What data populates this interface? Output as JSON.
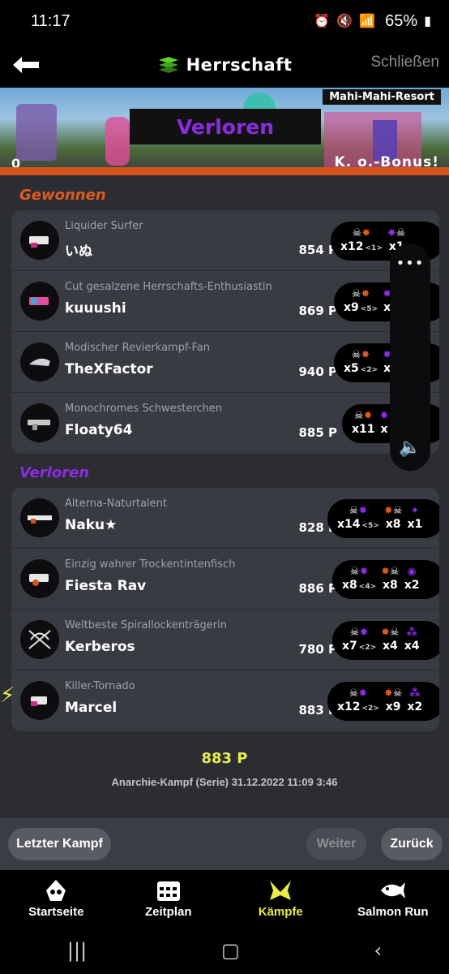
{
  "status": {
    "time": "11:17",
    "battery": "65%"
  },
  "header": {
    "title": "Herrschaft",
    "close_label": "Schließen"
  },
  "banner": {
    "stage": "Mahi-Mahi-Resort",
    "result": "Verloren",
    "score_left": "0",
    "ko_label": "K. o.-Bonus!"
  },
  "won_label": "Gewonnen",
  "lost_label": "Verloren",
  "won_team": [
    {
      "title": "Liquider Surfer",
      "nick": "いぬ",
      "points": "854 P",
      "kills": "x12",
      "assist": "<1>",
      "specials": "x1",
      "special2": "1"
    },
    {
      "title": "Cut gesalzene Herrschafts-Enthusiastin",
      "nick": "kuuushi",
      "points": "869 P",
      "kills": "x9",
      "assist": "<5>",
      "specials": "x",
      "special2": ""
    },
    {
      "title": "Modischer Revierkampf-Fan",
      "nick": "TheXFactor",
      "points": "940 P",
      "kills": "x5",
      "assist": "<2>",
      "specials": "x",
      "special2": ""
    },
    {
      "title": "Monochromes Schwesterchen",
      "nick": "Floaty64",
      "points": "885 P",
      "kills": "x11",
      "assist": "",
      "specials": "x",
      "special2": ""
    }
  ],
  "lost_team": [
    {
      "title": "Alterna-Naturtalent",
      "nick": "Naku★",
      "points": "828 P",
      "kills": "x14",
      "assist": "<5>",
      "deaths": "x8",
      "specials": "x1"
    },
    {
      "title": "Einzig wahrer Trockentintenfisch",
      "nick": "Fiesta Rav",
      "points": "886 P",
      "kills": "x8",
      "assist": "<4>",
      "deaths": "x8",
      "specials": "x2"
    },
    {
      "title": "Weltbeste Spirallockenträgerin",
      "nick": "Kerberos",
      "points": "780 P",
      "kills": "x7",
      "assist": "<2>",
      "deaths": "x4",
      "specials": "x4"
    },
    {
      "title": "Killer-Tornado",
      "nick": "Marcel",
      "points": "883 P",
      "kills": "x12",
      "assist": "<2>",
      "deaths": "x9",
      "specials": "x2"
    }
  ],
  "summary": {
    "points": "883 P",
    "meta": "Anarchie-Kampf (Serie) 31.12.2022 11:09 3:46"
  },
  "actions": {
    "last": "Letzter Kampf",
    "next": "Weiter",
    "back": "Zurück"
  },
  "nav": [
    {
      "label": "Startseite"
    },
    {
      "label": "Zeitplan"
    },
    {
      "label": "Kämpfe"
    },
    {
      "label": "Salmon Run"
    }
  ],
  "colors": {
    "winner": "#e05a1e",
    "loser": "#8b2ce0",
    "highlight": "#e8ec4a"
  }
}
